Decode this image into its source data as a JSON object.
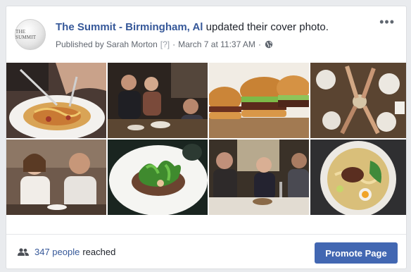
{
  "post": {
    "page_name": "The Summit - Birmingham, Al",
    "action": "updated their cover photo.",
    "published_by": "Published by Sarah Morton",
    "help_marker": "[?]",
    "separator": "·",
    "date": "March 7 at 11:37 AM",
    "avatar_text": "THE SUMMIT",
    "more_label": "•••",
    "privacy_icon": "globe-icon"
  },
  "photos": [
    {
      "name": "pasta-plate-photo"
    },
    {
      "name": "restaurant-diners-photo"
    },
    {
      "name": "burgers-photo"
    },
    {
      "name": "table-toast-photo"
    },
    {
      "name": "couple-dining-photo"
    },
    {
      "name": "salad-plate-photo"
    },
    {
      "name": "friends-dinner-photo"
    },
    {
      "name": "ramen-bowl-photo"
    }
  ],
  "footer": {
    "reach_count": "347 people",
    "reach_suffix": "reached",
    "promote_label": "Promote Page",
    "people_icon": "people-icon"
  },
  "colors": {
    "link": "#365899",
    "button": "#4267b2",
    "background": "#e9ebee"
  }
}
